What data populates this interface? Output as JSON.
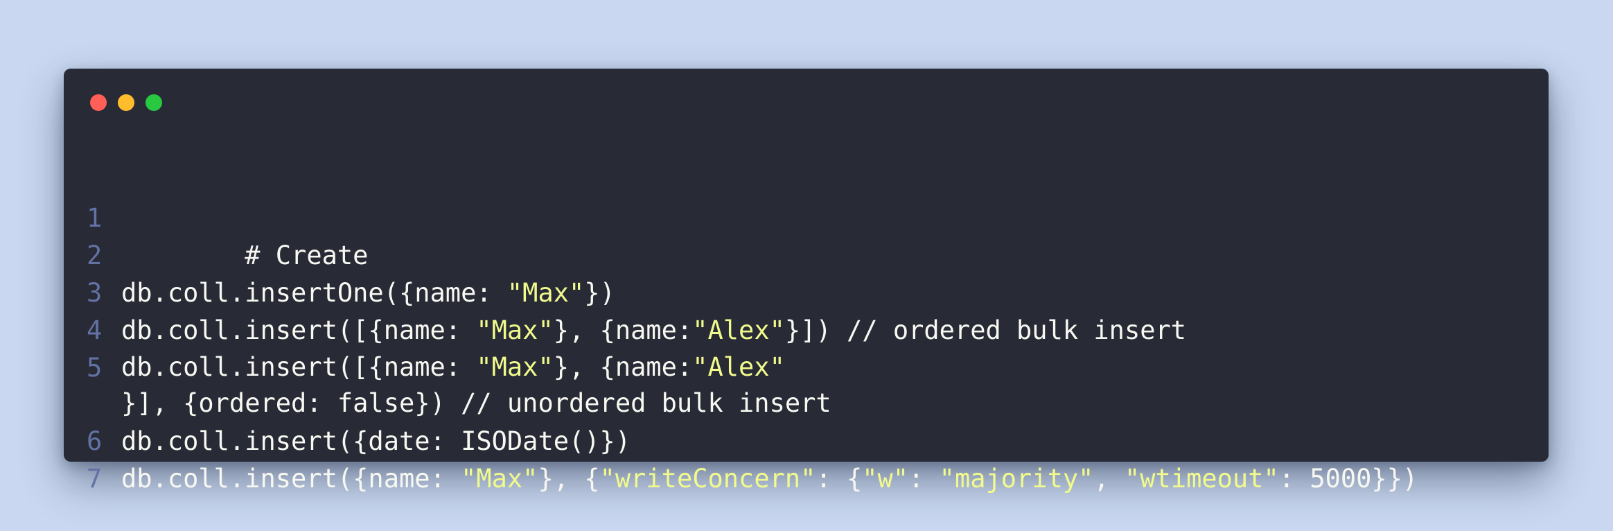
{
  "window": {
    "controls": [
      {
        "name": "close",
        "color": "#ff5f57"
      },
      {
        "name": "minimize",
        "color": "#ffbd2e"
      },
      {
        "name": "maximize",
        "color": "#28c940"
      }
    ]
  },
  "code": {
    "lines": [
      {
        "number": "1",
        "tokens": [
          {
            "text": "# Create",
            "kind": "plain"
          }
        ]
      },
      {
        "number": "2",
        "tokens": []
      },
      {
        "number": "3",
        "tokens": [
          {
            "text": "db.coll.insertOne({name: ",
            "kind": "plain"
          },
          {
            "text": "\"Max\"",
            "kind": "string"
          },
          {
            "text": "})",
            "kind": "plain"
          }
        ]
      },
      {
        "number": "4",
        "tokens": [
          {
            "text": "db.coll.insert([{name: ",
            "kind": "plain"
          },
          {
            "text": "\"Max\"",
            "kind": "string"
          },
          {
            "text": "}, {name:",
            "kind": "plain"
          },
          {
            "text": "\"Alex\"",
            "kind": "string"
          },
          {
            "text": "}]) // ordered bulk insert",
            "kind": "plain"
          }
        ]
      },
      {
        "number": "5",
        "wrapped": true,
        "tokens": [
          {
            "text": "db.coll.insert([{name: ",
            "kind": "plain"
          },
          {
            "text": "\"Max\"",
            "kind": "string"
          },
          {
            "text": "}, {name:",
            "kind": "plain"
          },
          {
            "text": "\"Alex\"",
            "kind": "string"
          },
          {
            "text": "\n}], {ordered: false}) // unordered bulk insert",
            "kind": "plain"
          }
        ]
      },
      {
        "number": "6",
        "tokens": [
          {
            "text": "db.coll.insert({date: ISODate()})",
            "kind": "plain"
          }
        ]
      },
      {
        "number": "7",
        "tokens": [
          {
            "text": "db.coll.insert({name: ",
            "kind": "plain"
          },
          {
            "text": "\"Max\"",
            "kind": "string"
          },
          {
            "text": "}, {",
            "kind": "plain"
          },
          {
            "text": "\"writeConcern\"",
            "kind": "string"
          },
          {
            "text": ": {",
            "kind": "plain"
          },
          {
            "text": "\"w\"",
            "kind": "string"
          },
          {
            "text": ": ",
            "kind": "plain"
          },
          {
            "text": "\"majority\"",
            "kind": "string"
          },
          {
            "text": ", ",
            "kind": "plain"
          },
          {
            "text": "\"wtimeout\"",
            "kind": "string"
          },
          {
            "text": ": 5000}})",
            "kind": "plain"
          }
        ]
      }
    ]
  }
}
